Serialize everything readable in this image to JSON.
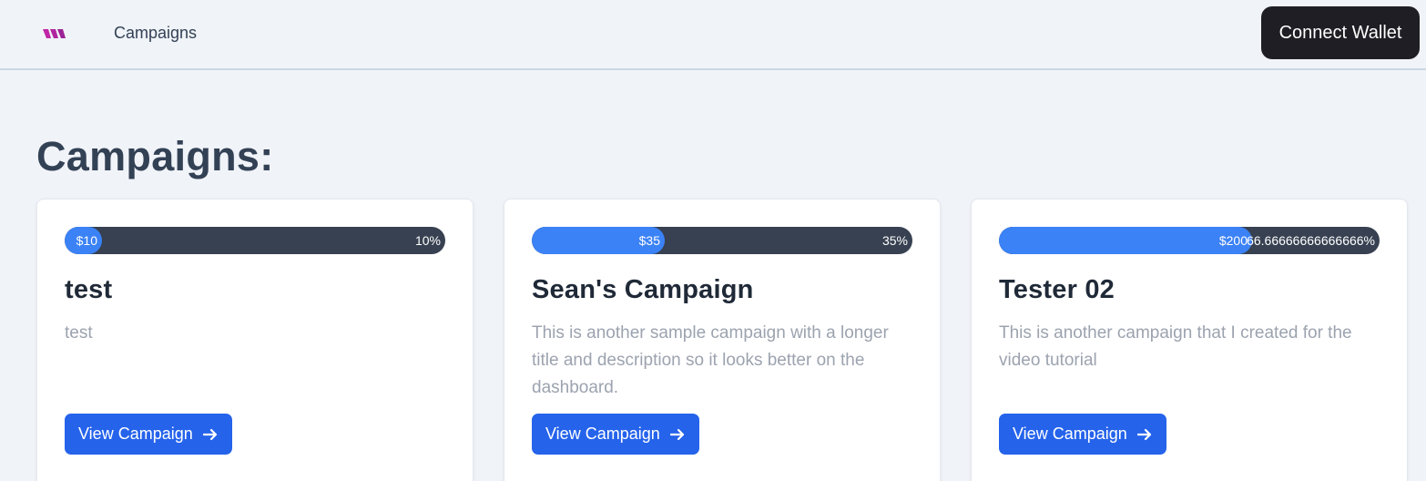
{
  "header": {
    "logo_icon": "brand-logo-icon",
    "nav_campaigns": "Campaigns",
    "connect_wallet": "Connect Wallet"
  },
  "main": {
    "title": "Campaigns:"
  },
  "colors": {
    "accent": "#2563eb",
    "progress_fill": "#3b82f6",
    "progress_track": "#374151",
    "connect_button": "#1e1e24",
    "logo": "#c026a5"
  },
  "campaigns": [
    {
      "raised": "$10",
      "percent_label": "10%",
      "progress_fraction": 0.1,
      "title": "test",
      "description": "test",
      "button_label": "View Campaign",
      "button_icon": "arrow-right-icon"
    },
    {
      "raised": "$35",
      "percent_label": "35%",
      "progress_fraction": 0.35,
      "title": "Sean's Campaign",
      "description": "This is another sample campaign with a longer title and description so it looks better on the dashboard.",
      "button_label": "View Campaign",
      "button_icon": "arrow-right-icon"
    },
    {
      "raised": "$200",
      "percent_label": "66.66666666666666%",
      "progress_fraction": 0.6667,
      "title": "Tester 02",
      "description": "This is another campaign that I created for the video tutorial",
      "button_label": "View Campaign",
      "button_icon": "arrow-right-icon"
    }
  ]
}
